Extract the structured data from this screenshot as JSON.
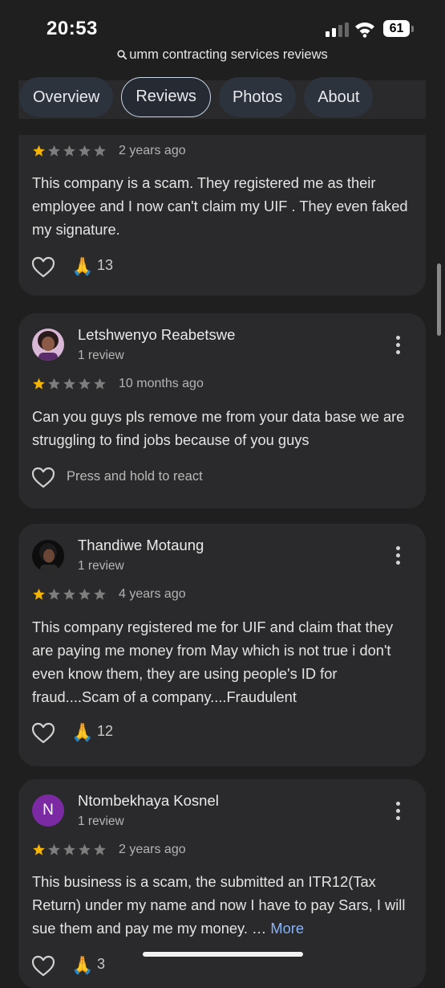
{
  "status_bar": {
    "time": "20:53",
    "battery": "61"
  },
  "search": {
    "query": "umm contracting services reviews"
  },
  "tabs": [
    {
      "label": "Overview"
    },
    {
      "label": "Reviews",
      "active": true
    },
    {
      "label": "Photos"
    },
    {
      "label": "About"
    }
  ],
  "reviews": [
    {
      "rating": 1,
      "time": "2 years ago",
      "text": "This company is a scam. They registered me as their employee and I now can't claim my UIF . They even faked my signature.",
      "reaction_emoji": "🙏",
      "reaction_count": "13"
    },
    {
      "name": "Letshwenyo Reabetswe",
      "review_count": "1 review",
      "rating": 1,
      "time": "10 months ago",
      "text": "Can you guys pls remove me from your data base we are struggling to find jobs because of you guys",
      "react_hint": "Press and hold to react"
    },
    {
      "name": "Thandiwe Motaung",
      "review_count": "1 review",
      "rating": 1,
      "time": "4 years ago",
      "text": "This company registered me for UIF and claim that they are paying me money from May which is not true i don't even know them, they are using people's ID for fraud....Scam of a company....Fraudulent",
      "reaction_emoji": "🙏",
      "reaction_count": "12"
    },
    {
      "name": "Ntombekhaya Kosnel",
      "avatar_letter": "N",
      "review_count": "1 review",
      "rating": 1,
      "time": "2 years ago",
      "text": "This business is a scam, the submitted an ITR12(Tax Return) under my name and now I have to pay Sars, I will sue them and pay me my money. …",
      "more_label": "More",
      "reaction_emoji": "🙏",
      "reaction_count": "3"
    }
  ],
  "colors": {
    "star_filled": "#f4b400",
    "star_empty": "#7d7d7d",
    "link": "#8ab4f8",
    "avatar_n": "#7b2aa3"
  }
}
